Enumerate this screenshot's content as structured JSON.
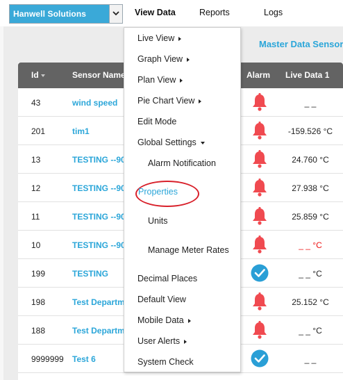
{
  "header": {
    "company": "Hanwell Solutions",
    "nav": {
      "view_data": "View Data",
      "reports": "Reports",
      "logs": "Logs"
    }
  },
  "page": {
    "title": "Master Data Sensors"
  },
  "table": {
    "columns": {
      "id": "Id",
      "name": "Sensor Name",
      "alarm": "Alarm",
      "live": "Live Data 1"
    },
    "rows": [
      {
        "id": "43",
        "name": "wind speed",
        "alarm": "bell",
        "live": "_ _"
      },
      {
        "id": "201",
        "name": "tim1",
        "alarm": "bell",
        "live": "-159.526 °C"
      },
      {
        "id": "13",
        "name": "TESTING --90",
        "alarm": "bell",
        "live": "24.760 °C"
      },
      {
        "id": "12",
        "name": "TESTING --90",
        "alarm": "bell",
        "live": "27.938 °C"
      },
      {
        "id": "11",
        "name": "TESTING --90",
        "alarm": "bell",
        "live": "25.859 °C"
      },
      {
        "id": "10",
        "name": "TESTING --90",
        "alarm": "bell",
        "live": "_ _ °C",
        "live_alarm": true
      },
      {
        "id": "199",
        "name": "TESTING",
        "alarm": "check",
        "live": "_ _ °C"
      },
      {
        "id": "198",
        "name": "Test Departm",
        "alarm": "bell",
        "live": "25.152 °C"
      },
      {
        "id": "188",
        "name": "Test Departm",
        "alarm": "bell",
        "live": "_ _ °C"
      },
      {
        "id": "9999999",
        "name": "Test 6",
        "alarm": "check",
        "live": "_ _"
      }
    ]
  },
  "menu": {
    "live_view": "Live View",
    "graph_view": "Graph View",
    "plan_view": "Plan View",
    "pie_chart_view": "Pie Chart View",
    "edit_mode": "Edit Mode",
    "global_settings": "Global Settings",
    "alarm_notification": "Alarm Notification",
    "properties": "Properties",
    "units": "Units",
    "manage_meter_rates": "Manage Meter Rates",
    "decimal_places": "Decimal Places",
    "default_view": "Default View",
    "mobile_data": "Mobile Data",
    "user_alerts": "User Alerts",
    "system_check": "System Check"
  },
  "colors": {
    "accent": "#2ba6d9",
    "alarm": "#f04a50",
    "ok": "#2a9fd6",
    "header": "#636363",
    "highlight_ring": "#d8202a"
  }
}
